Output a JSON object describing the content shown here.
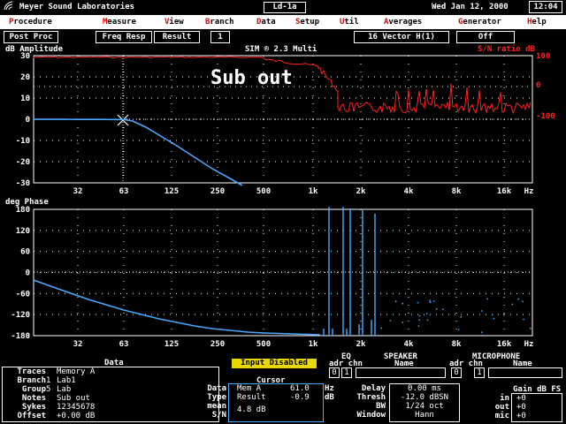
{
  "app_title": "Meyer Sound Laboratories",
  "file_name": "Ld-1a",
  "date": "Wed Jan 12, 2000",
  "time": "12:04",
  "menu": [
    {
      "hotkey": "P",
      "rest": "rocedure"
    },
    {
      "hotkey": "M",
      "rest": "easure"
    },
    {
      "hotkey": "V",
      "rest": "iew"
    },
    {
      "hotkey": "B",
      "rest": "ranch"
    },
    {
      "hotkey": "D",
      "rest": "ata"
    },
    {
      "hotkey": "S",
      "rest": "etup"
    },
    {
      "hotkey": "U",
      "rest": "til"
    },
    {
      "hotkey": "A",
      "rest": "verages"
    },
    {
      "hotkey": "G",
      "rest": "enerator"
    },
    {
      "hotkey": "H",
      "rest": "elp"
    }
  ],
  "toolbar": {
    "post_proc": "Post Proc",
    "freq_resp": "Freq Resp",
    "result": "Result",
    "one": "1",
    "sim_label": "SIM ® 2.3 Multi",
    "vector": "16  Vector H(1)",
    "off": "Off"
  },
  "amplitude_plot": {
    "ylabel": "dB Amplitude",
    "right_label": "S/N ratio dB",
    "overlay_text": "Sub out",
    "y_ticks": [
      "30",
      "20",
      "10",
      "0",
      "-10",
      "-20",
      "-30"
    ],
    "right_ticks": [
      "100",
      "0",
      "-100"
    ],
    "x_ticks": [
      "32",
      "63",
      "125",
      "250",
      "500",
      "1k",
      "2k",
      "4k",
      "8k",
      "16k",
      "Hz"
    ]
  },
  "phase_plot": {
    "ylabel": "deg Phase",
    "y_ticks": [
      "180",
      "120",
      "60",
      "0",
      "-60",
      "-120",
      "-180"
    ],
    "x_ticks": [
      "32",
      "63",
      "125",
      "250",
      "500",
      "1k",
      "2k",
      "4k",
      "8k",
      "16k",
      "Hz"
    ]
  },
  "data_panel": {
    "header": "Data",
    "rows": [
      {
        "label": "Traces",
        "num": "",
        "value": "Memory A"
      },
      {
        "label": "Branch",
        "num": "1",
        "value": "Lab1"
      },
      {
        "label": "Group",
        "num": "5",
        "value": "Lab"
      },
      {
        "label": "Notes",
        "num": "",
        "value": "Sub out"
      },
      {
        "label": "Sykes",
        "num": "",
        "value": "12345678"
      },
      {
        "label": "Offset",
        "num": "",
        "value": "+0.00 dB"
      }
    ]
  },
  "input_disabled": "Input Disabled",
  "cursor_panel": {
    "header": "Cursor",
    "labels": [
      "Data",
      "Type",
      "mean",
      "S/N"
    ],
    "data_name": "Mem A",
    "data_value": "61.0",
    "data_unit": "Hz",
    "type_name": "Result",
    "type_value": "-0.9",
    "type_unit": "dB",
    "sn_value": "4.8 dB"
  },
  "eq_panel": {
    "header": "EQ",
    "sub": "adr chn",
    "adr": "0",
    "chn": "1"
  },
  "speaker_panel": {
    "header": "SPEAKER",
    "sub": "Name"
  },
  "mic_panel": {
    "header": "MICROPHONE",
    "sub": "Name",
    "sub2": "adr chn",
    "adr": "0",
    "chn": "1"
  },
  "settings_panel": {
    "rows": [
      {
        "label": "Delay",
        "value": "0.00 ms"
      },
      {
        "label": "Thresh",
        "value": "-12.0 dBSN"
      },
      {
        "label": "BW",
        "value": "1/24 oct"
      },
      {
        "label": "Window",
        "value": "Hann"
      }
    ]
  },
  "gain_panel": {
    "header": "Gain dB FS",
    "rows": [
      {
        "label": "in",
        "value": "+0"
      },
      {
        "label": "out",
        "value": "+0"
      },
      {
        "label": "mic",
        "value": "+0"
      }
    ]
  },
  "colors": {
    "amplitude_trace": "#4aa8ff",
    "sn_trace": "#ff2020",
    "grid": "#ffffff",
    "menu_hotkey": "#e00000"
  }
}
